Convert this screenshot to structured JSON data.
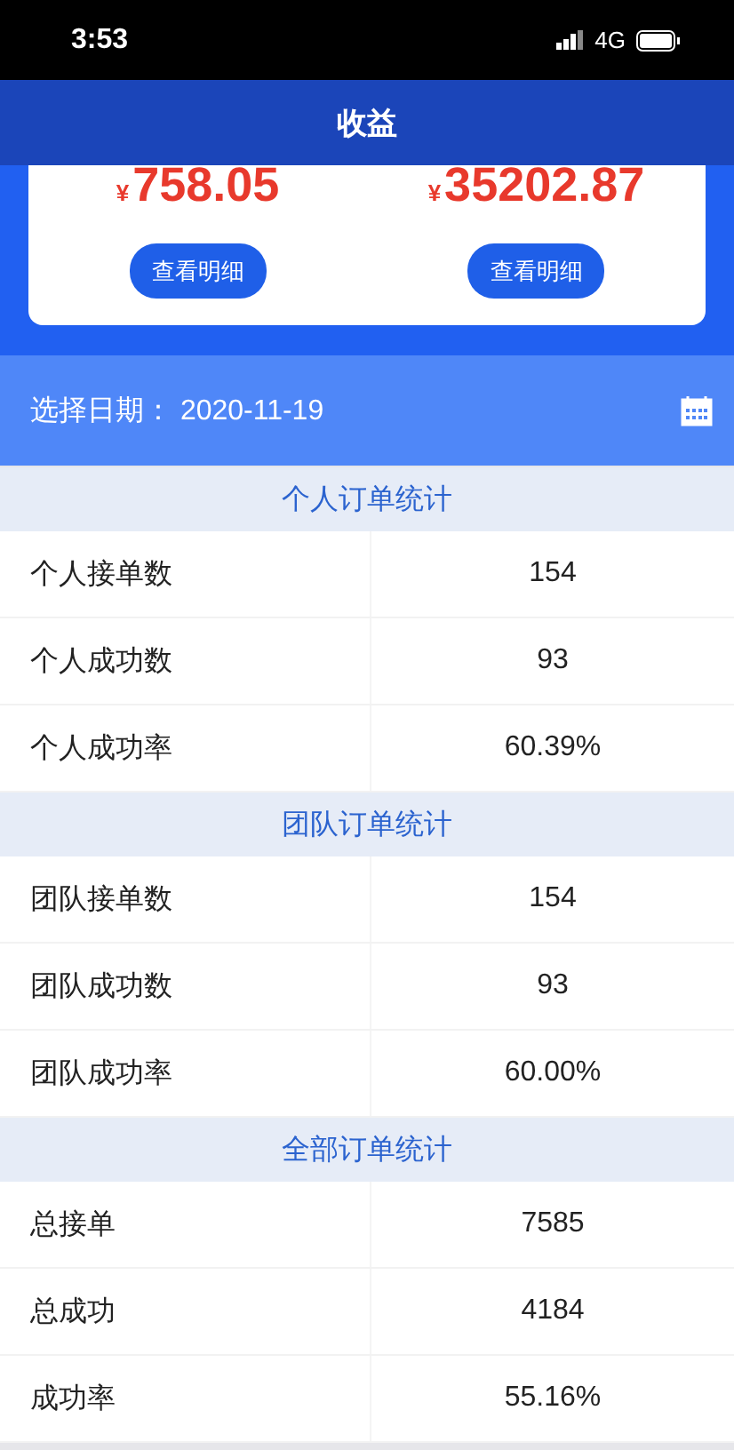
{
  "status_bar": {
    "time": "3:53",
    "network": "4G"
  },
  "header": {
    "title": "收益"
  },
  "earnings": [
    {
      "currency": "¥",
      "amount": "758.05",
      "button": "查看明细"
    },
    {
      "currency": "¥",
      "amount": "35202.87",
      "button": "查看明细"
    }
  ],
  "date_bar": {
    "label": "选择日期：",
    "value": "2020-11-19"
  },
  "sections": [
    {
      "title": "个人订单统计",
      "rows": [
        {
          "label": "个人接单数",
          "value": "154"
        },
        {
          "label": "个人成功数",
          "value": "93"
        },
        {
          "label": "个人成功率",
          "value": "60.39%"
        }
      ]
    },
    {
      "title": "团队订单统计",
      "rows": [
        {
          "label": "团队接单数",
          "value": "154"
        },
        {
          "label": "团队成功数",
          "value": "93"
        },
        {
          "label": "团队成功率",
          "value": "60.00%"
        }
      ]
    },
    {
      "title": "全部订单统计",
      "rows": [
        {
          "label": "总接单",
          "value": "7585"
        },
        {
          "label": "总成功",
          "value": "4184"
        },
        {
          "label": "成功率",
          "value": "55.16%"
        }
      ]
    }
  ]
}
